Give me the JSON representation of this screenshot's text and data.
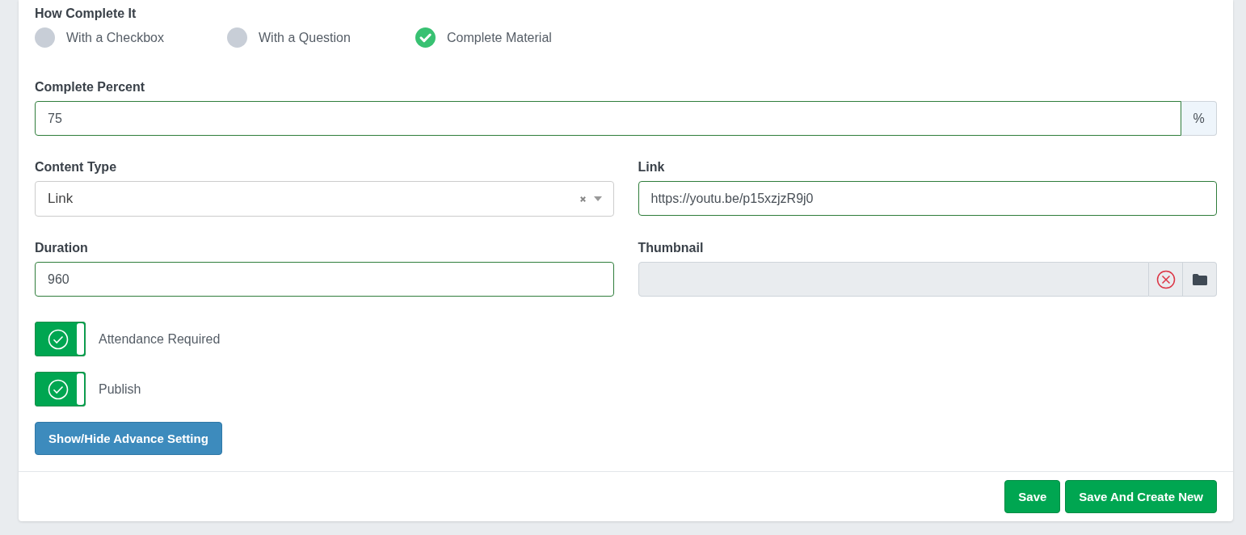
{
  "how_complete": {
    "label": "How Complete It",
    "options": [
      {
        "label": "With a Checkbox",
        "selected": false
      },
      {
        "label": "With a Question",
        "selected": false
      },
      {
        "label": "Complete Material",
        "selected": true
      }
    ]
  },
  "complete_percent": {
    "label": "Complete Percent",
    "value": "75",
    "suffix": "%"
  },
  "content_type": {
    "label": "Content Type",
    "value": "Link"
  },
  "link": {
    "label": "Link",
    "value": "https://youtu.be/p15xzjzR9j0"
  },
  "duration": {
    "label": "Duration",
    "value": "960"
  },
  "thumbnail": {
    "label": "Thumbnail"
  },
  "toggles": [
    {
      "label": "Attendance Required",
      "on": true
    },
    {
      "label": "Publish",
      "on": true
    }
  ],
  "advance_button": "Show/Hide Advance Setting",
  "footer_buttons": [
    "Save",
    "Save And Create New"
  ]
}
